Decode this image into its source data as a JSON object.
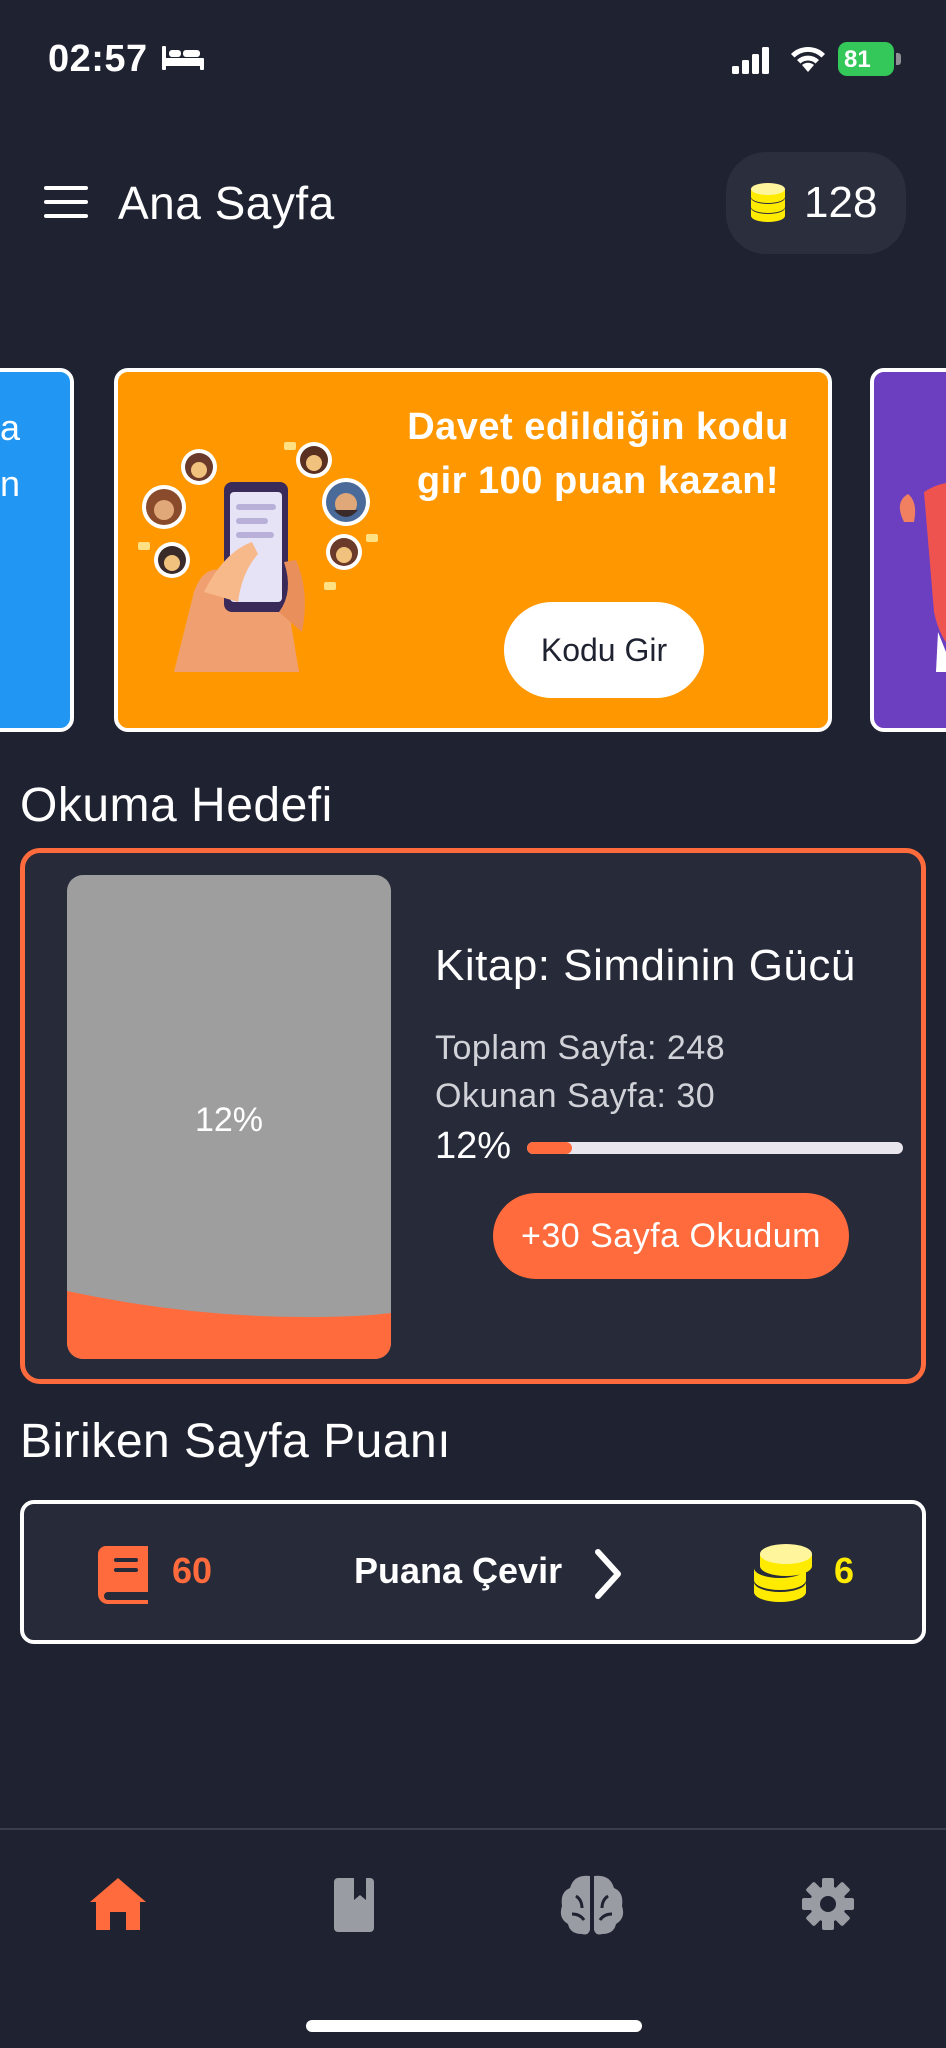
{
  "status_bar": {
    "time": "02:57",
    "battery": "81"
  },
  "header": {
    "title": "Ana Sayfa",
    "coins": "128"
  },
  "carousel": {
    "left_peek_text": "a\nn",
    "main_banner": {
      "line1": "Davet edildiğin kodu",
      "line2": "gir 100 puan kazan!",
      "button_label": "Kodu Gir"
    }
  },
  "reading_goal": {
    "section_title": "Okuma Hedefi",
    "cover_percent": "12%",
    "book_title": "Kitap: Simdinin Gücü",
    "total_pages": "Toplam Sayfa: 248",
    "read_pages": "Okunan Sayfa: 30",
    "progress_label": "12%",
    "progress_value": 0.12,
    "read_button_label": "+30 Sayfa Okudum"
  },
  "page_points": {
    "section_title": "Biriken Sayfa Puanı",
    "pages_count": "60",
    "convert_label": "Puana Çevir",
    "points_value": "6"
  },
  "colors": {
    "background": "#1f2230",
    "card": "#262a39",
    "accent": "#ff6b3d",
    "banner_orange": "#ff9800",
    "banner_blue": "#2196f3",
    "banner_purple": "#6b3fbf",
    "coin_yellow": "#ffeb00"
  },
  "bottom_nav": {
    "items": [
      {
        "icon": "home-icon",
        "active": true
      },
      {
        "icon": "book-icon",
        "active": false
      },
      {
        "icon": "brain-icon",
        "active": false
      },
      {
        "icon": "gear-icon",
        "active": false
      }
    ]
  }
}
